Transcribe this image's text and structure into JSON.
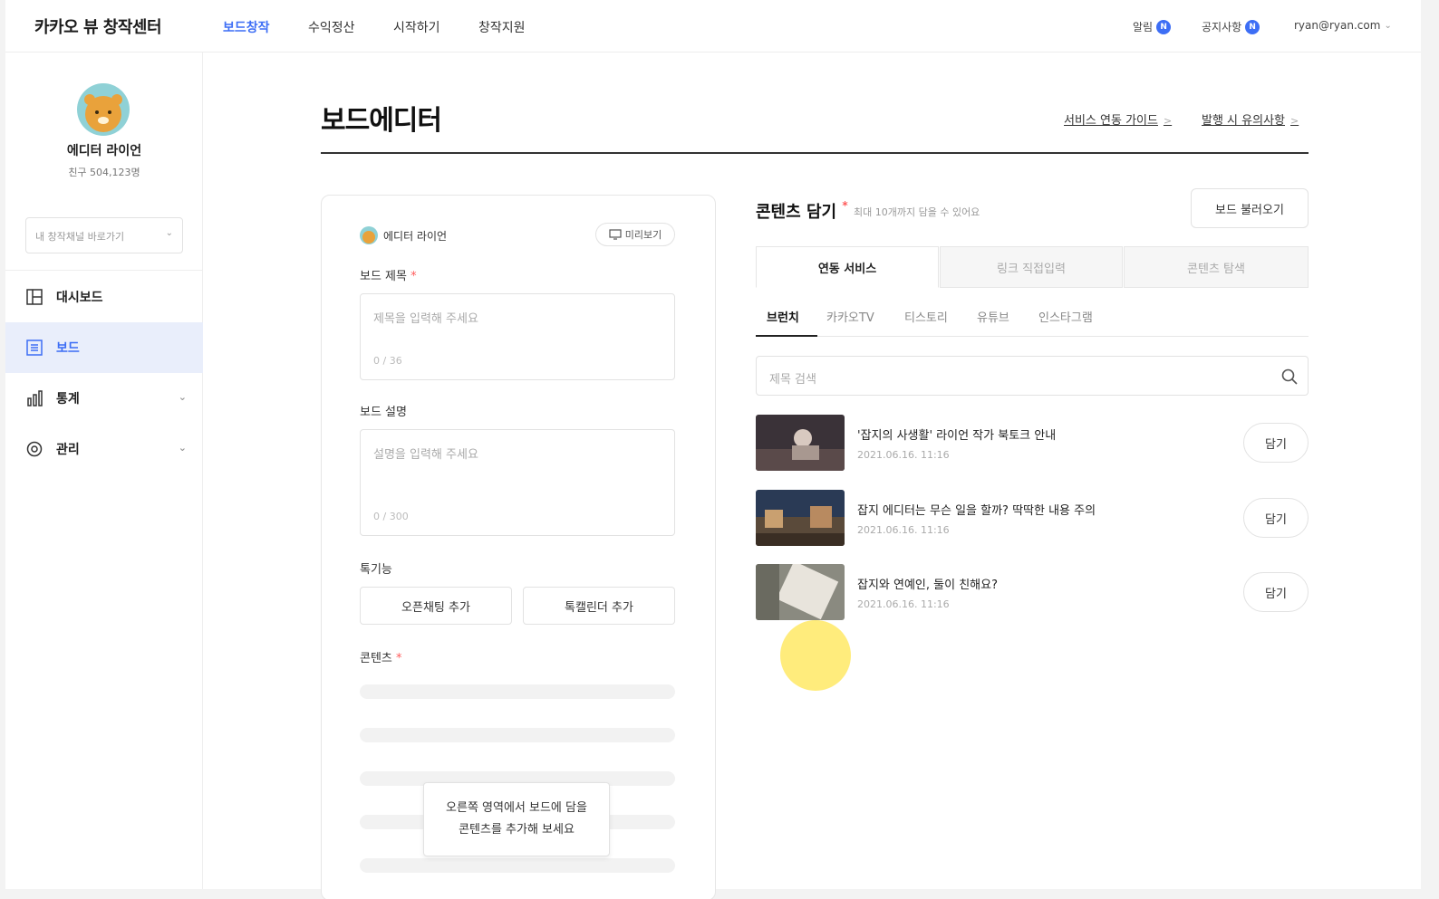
{
  "brand": "카카오 뷰 창작센터",
  "topnav": {
    "items": [
      "보드창작",
      "수익정산",
      "시작하기",
      "창작지원"
    ],
    "alert_label": "알림",
    "alert_badge": "N",
    "notice_label": "공지사항",
    "notice_badge": "N",
    "account": "ryan@ryan.com"
  },
  "sidebar": {
    "profile_name": "에디터 라이언",
    "friends": "친구 504,123명",
    "channel_placeholder": "내 창작채널 바로가기",
    "items": [
      {
        "label": "대시보드",
        "icon": "dashboard-icon"
      },
      {
        "label": "보드",
        "icon": "board-icon",
        "active": true
      },
      {
        "label": "통계",
        "icon": "chart-icon"
      },
      {
        "label": "관리",
        "icon": "gear-icon"
      }
    ]
  },
  "main": {
    "title": "보드에디터",
    "link_guide": "서비스 연동 가이드",
    "link_notice": "발행 시 유의사항"
  },
  "editor": {
    "author": "에디터 라이언",
    "preview": "미리보기",
    "title_label": "보드 제목",
    "required_mark": "*",
    "title_placeholder": "제목을 입력해 주세요",
    "title_count": "0 / 36",
    "desc_label": "보드 설명",
    "desc_placeholder": "설명을 입력해 주세요",
    "desc_count": "0 / 300",
    "special_label": "톡기능",
    "open_chat": "오픈채팅 추가",
    "talk_calendar": "톡캘린더 추가",
    "content_label": "콘텐츠",
    "tooltip_line1": "오른쪽 영역에서 보드에 담을",
    "tooltip_line2": "콘텐츠를 추가해 보세요"
  },
  "content_panel": {
    "title": "콘텐츠 담기",
    "required_mark": "*",
    "subtitle": "최대 10개까지 담을 수 있어요",
    "load_board": "보드 불러오기",
    "segments": [
      "연동 서비스",
      "링크 직접입력",
      "콘텐츠 탐색"
    ],
    "subtabs": [
      "브런치",
      "카카오TV",
      "티스토리",
      "유튜브",
      "인스타그램"
    ],
    "search_placeholder": "제목 검색",
    "add_label": "담기",
    "items": [
      {
        "title": "'잡지의 사생활' 라이언 작가 북토크 안내",
        "date": "2021.06.16. 11:16"
      },
      {
        "title": "잡지 에디터는 무슨 일을 할까? 딱딱한 내용 주의",
        "date": "2021.06.16. 11:16"
      },
      {
        "title": "잡지와 연예인, 둘이 친해요?",
        "date": "2021.06.16. 11:16"
      }
    ]
  },
  "colors": {
    "accent": "#3d6ef5",
    "required": "#ff5a5a",
    "active_bg": "#e9eefb"
  }
}
